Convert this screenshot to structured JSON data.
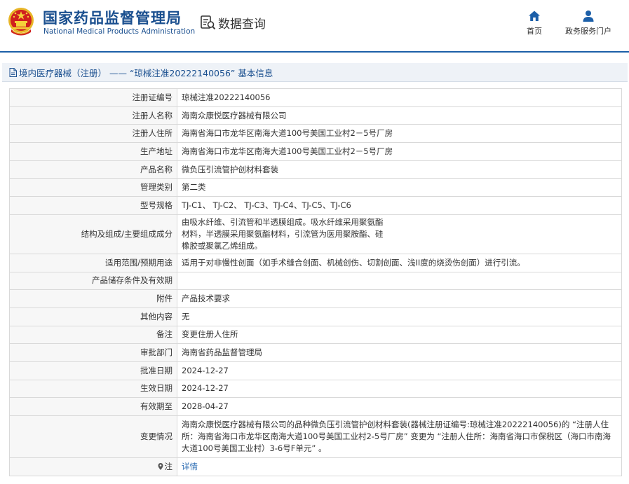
{
  "header": {
    "agency_cn": "国家药品监督管理局",
    "agency_en": "National Medical Products Administration",
    "page_kicker": "数据查询",
    "nav": [
      {
        "label": "首页",
        "icon": "home-icon"
      },
      {
        "label": "政务服务门户",
        "icon": "user-icon"
      }
    ]
  },
  "title": "境内医疗器械（注册） —— “琼械注准20222140056” 基本信息",
  "fields": [
    {
      "label": "注册证编号",
      "value": "琼械注准20222140056"
    },
    {
      "label": "注册人名称",
      "value": "海南众康悦医疗器械有限公司"
    },
    {
      "label": "注册人住所",
      "value": "海南省海口市龙华区南海大道100号美国工业村2－5号厂房"
    },
    {
      "label": "生产地址",
      "value": "海南省海口市龙华区南海大道100号美国工业村2－5号厂房"
    },
    {
      "label": "产品名称",
      "value": "微负压引流管护创材料套装"
    },
    {
      "label": "管理类别",
      "value": "第二类"
    },
    {
      "label": "型号规格",
      "value": "TJ-C1、 TJ-C2、 TJ-C3、TJ-C4、TJ-C5、TJ-C6"
    },
    {
      "label": "结构及组成/主要组成成分",
      "value": "由吸水纤维、引流管和半透膜组成。吸水纤维采用聚氨酯\n材料，半透膜采用聚氨酯材料，引流管为医用聚胺酯、硅\n橡胶或聚氯乙烯组成。"
    },
    {
      "label": "适用范围/预期用途",
      "value": "适用于对非慢性创面（如手术缝合创面、机械创伤、切割创面、浅II度的烧烫伤创面）进行引流。"
    },
    {
      "label": "产品储存条件及有效期",
      "value": ""
    },
    {
      "label": "附件",
      "value": "产品技术要求"
    },
    {
      "label": "其他内容",
      "value": "无"
    },
    {
      "label": "备注",
      "value": "变更住册人住所"
    },
    {
      "label": "审批部门",
      "value": "海南省药品监督管理局"
    },
    {
      "label": "批准日期",
      "value": "2024-12-27"
    },
    {
      "label": "生效日期",
      "value": "2024-12-27"
    },
    {
      "label": "有效期至",
      "value": "2028-04-27"
    },
    {
      "label": "变更情况",
      "value": "海南众康悦医疗器械有限公司的品种微负压引流管护创材料套装(器械注册证编号:琼械注准20222140056)的 “注册人住所：海南省海口市龙华区南海大道100号美国工业村2-5号厂房” 变更为 “注册人住所：海南省海口市保税区（海口市南海大道100号美国工业村）3-6号F单元” 。"
    }
  ],
  "note_row": {
    "label": "注",
    "link": "详情"
  }
}
